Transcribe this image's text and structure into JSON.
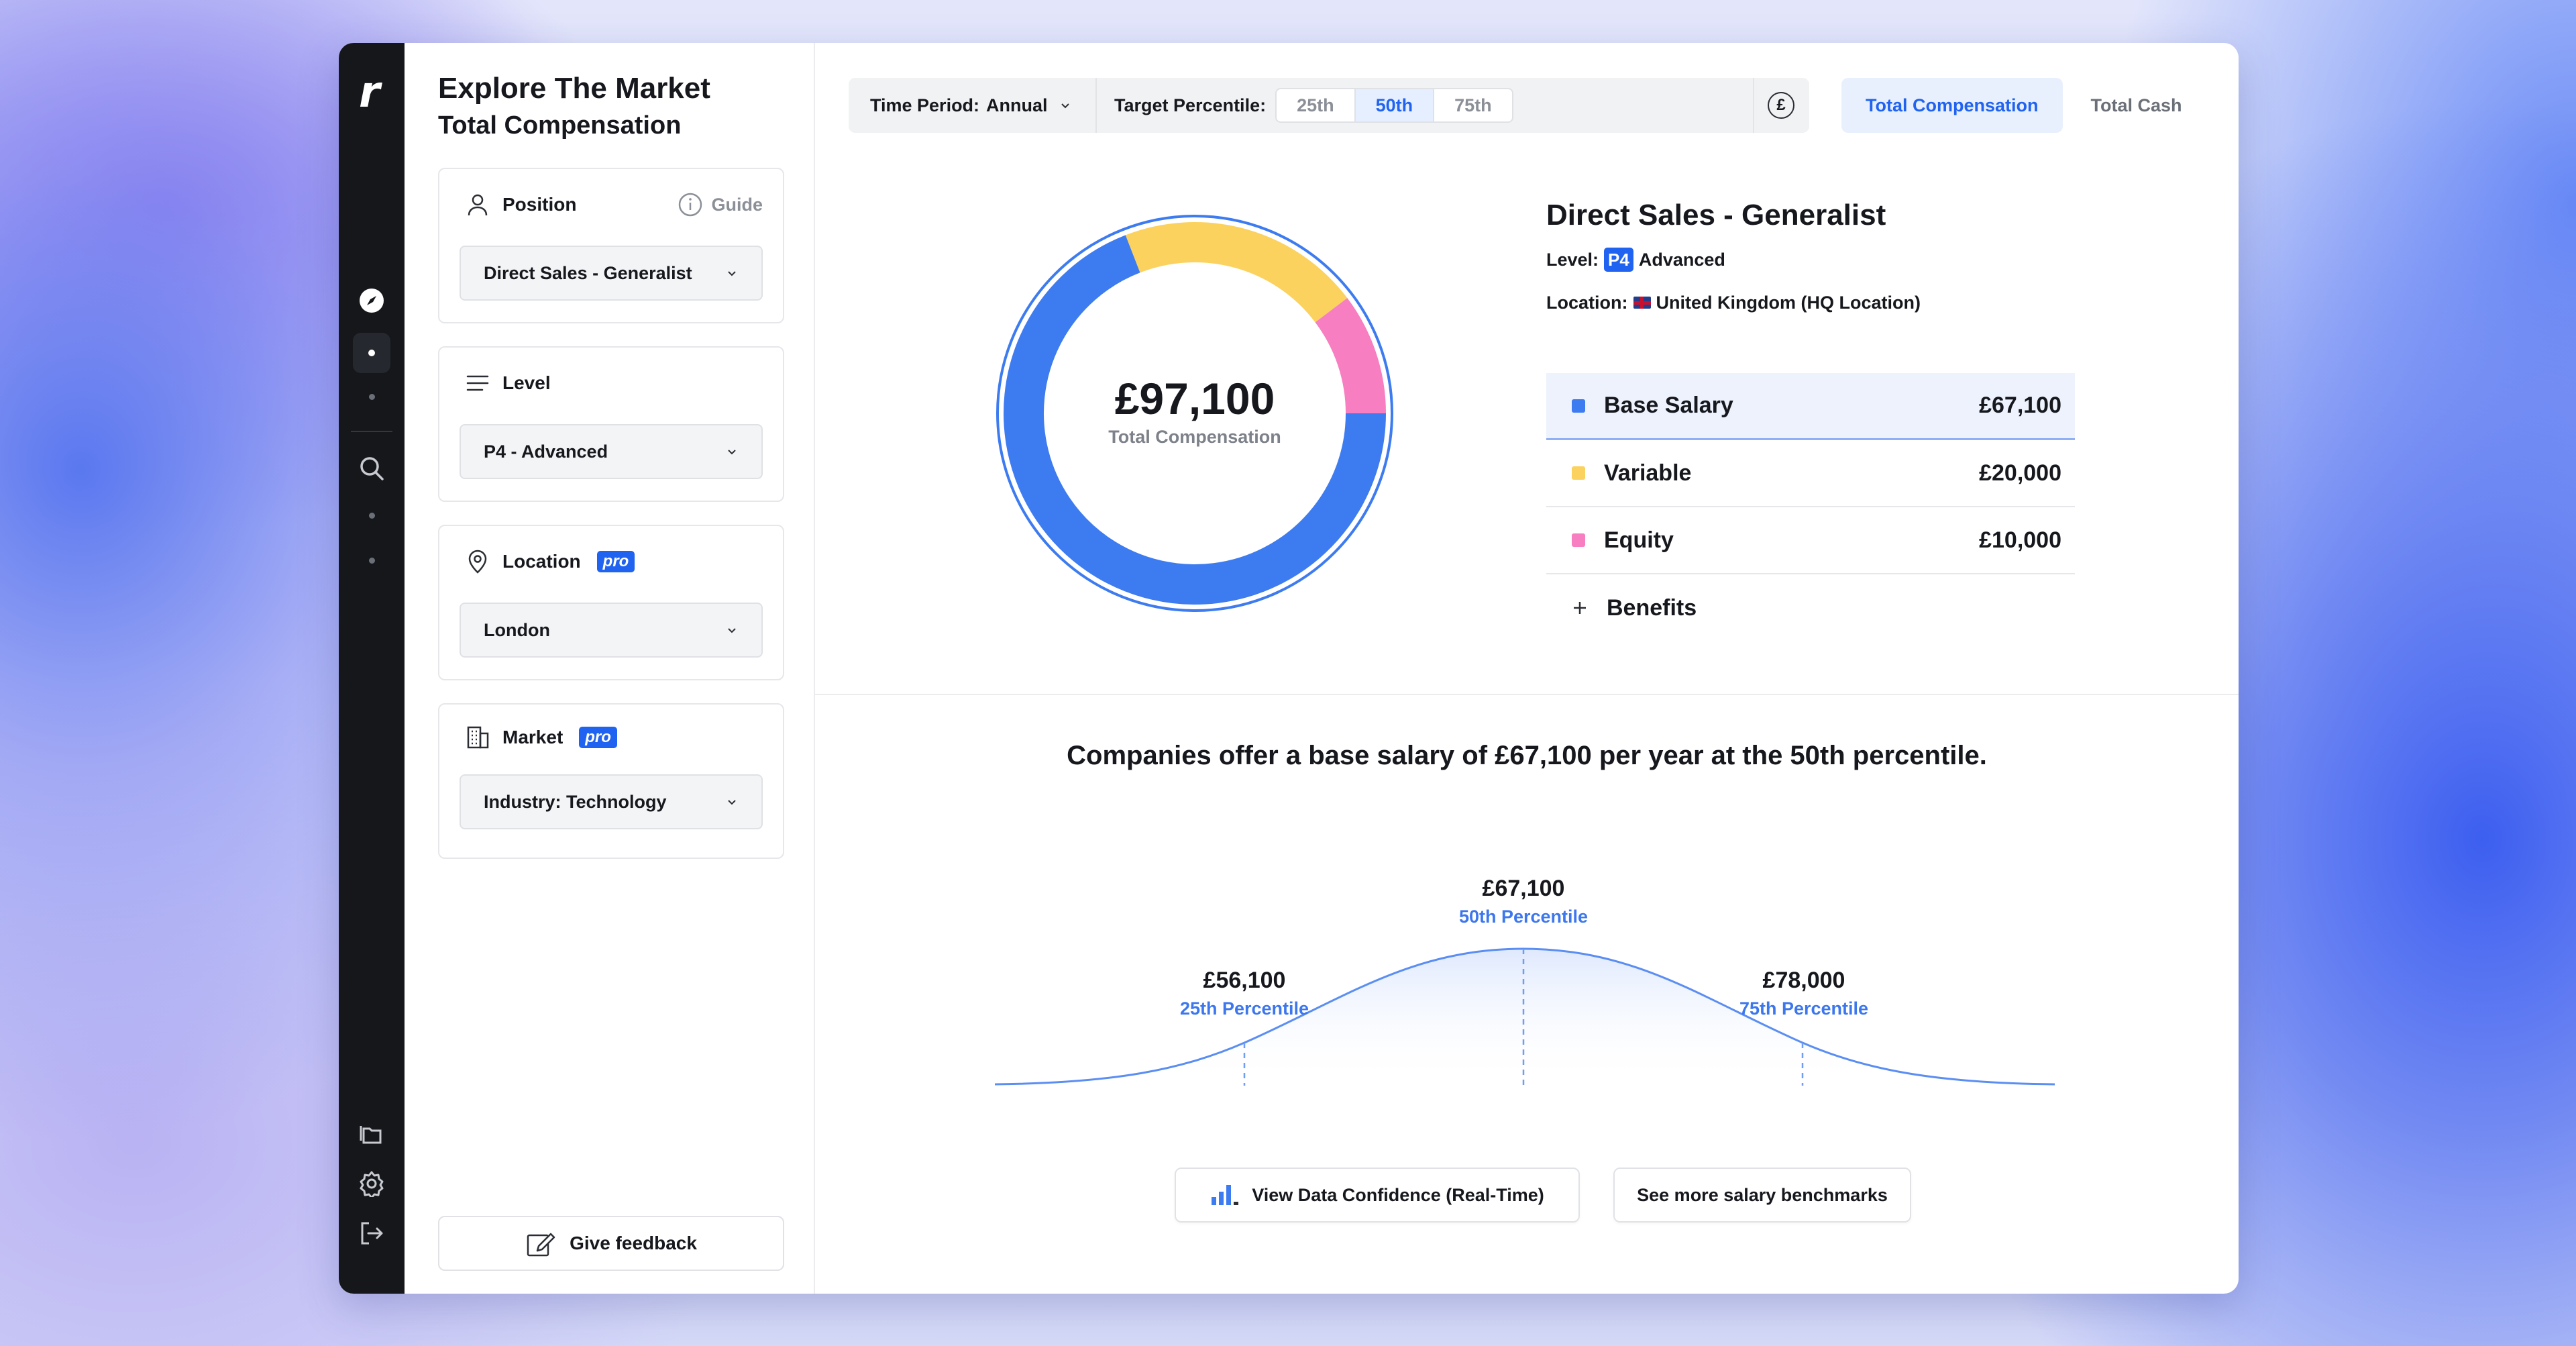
{
  "app": {
    "logo": "r"
  },
  "sidebar": {
    "title": "Explore The Market",
    "subtitle": "Total Compensation",
    "position": {
      "label": "Position",
      "guide": "Guide",
      "value": "Direct Sales - Generalist"
    },
    "level": {
      "label": "Level",
      "value": "P4 - Advanced"
    },
    "location": {
      "label": "Location",
      "badge": "pro",
      "value": "London"
    },
    "market": {
      "label": "Market",
      "badge": "pro",
      "value": "Industry: Technology"
    },
    "feedback": "Give feedback"
  },
  "toolbar": {
    "time_period_label": "Time Period:",
    "time_period_value": "Annual",
    "target_label": "Target Percentile:",
    "percentiles": [
      "25th",
      "50th",
      "75th"
    ],
    "selected_percentile": "50th",
    "currency_symbol": "£"
  },
  "tabs": {
    "total_comp": "Total Compensation",
    "total_cash": "Total Cash",
    "active": "Total Compensation"
  },
  "summary": {
    "total": "£97,100",
    "total_label": "Total Compensation",
    "title": "Direct Sales - Generalist",
    "level_label": "Level:",
    "level_badge": "P4",
    "level_value": "Advanced",
    "location_label": "Location:",
    "location_value": "United Kingdom (HQ Location)"
  },
  "breakdown": [
    {
      "name": "Base Salary",
      "value": "£67,100",
      "amount": 67100,
      "color": "#3d7bf0"
    },
    {
      "name": "Variable",
      "value": "£20,000",
      "amount": 20000,
      "color": "#fbd25d"
    },
    {
      "name": "Equity",
      "value": "£10,000",
      "amount": 10000,
      "color": "#f77ec0"
    }
  ],
  "benefits_label": "Benefits",
  "distribution": {
    "headline": "Companies offer a base salary of £67,100 per year at the 50th percentile.",
    "p25": {
      "value": "£56,100",
      "label": "25th Percentile"
    },
    "p50": {
      "value": "£67,100",
      "label": "50th Percentile"
    },
    "p75": {
      "value": "£78,000",
      "label": "75th Percentile"
    }
  },
  "actions": {
    "confidence": "View Data Confidence (Real-Time)",
    "benchmarks": "See more salary benchmarks"
  },
  "colors": {
    "accent": "#1f63f0",
    "rail": "#15171b",
    "base": "#3d7bf0",
    "variable": "#fbd25d",
    "equity": "#f77ec0"
  }
}
